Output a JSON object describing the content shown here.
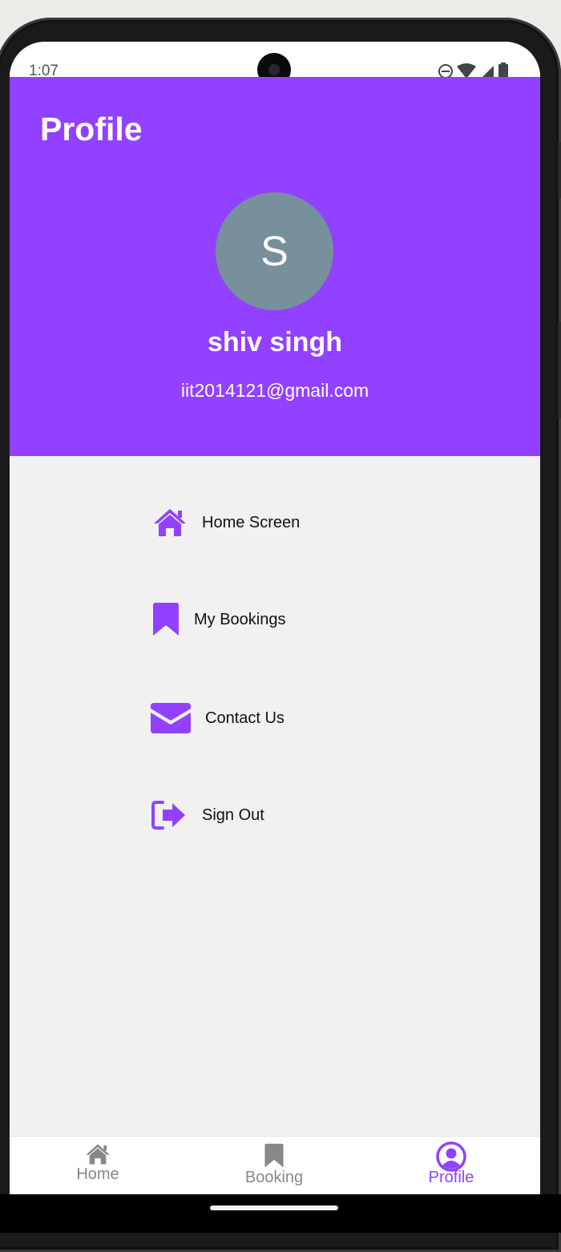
{
  "status_bar": {
    "time": "1:07",
    "icons": [
      "do-not-disturb-icon",
      "wifi-icon",
      "signal-icon",
      "battery-icon"
    ]
  },
  "header": {
    "title": "Profile",
    "avatar_initial": "S",
    "user_name": "shiv singh",
    "user_email": "iit2014121@gmail.com"
  },
  "menu": {
    "items": [
      {
        "label": "Home Screen",
        "icon": "home-icon"
      },
      {
        "label": "My Bookings",
        "icon": "bookmark-icon"
      },
      {
        "label": "Contact Us",
        "icon": "envelope-icon"
      },
      {
        "label": "Sign Out",
        "icon": "sign-out-icon"
      }
    ]
  },
  "bottom_nav": {
    "tabs": [
      {
        "label": "Home",
        "icon": "home-icon"
      },
      {
        "label": "Booking",
        "icon": "bookmark-icon"
      },
      {
        "label": "Profile",
        "icon": "user-circle-icon",
        "active": true
      }
    ]
  },
  "colors": {
    "accent": "#9141ff",
    "avatar_bg": "#78909c",
    "inactive_tab": "#888888",
    "background": "#f1f1f1"
  }
}
